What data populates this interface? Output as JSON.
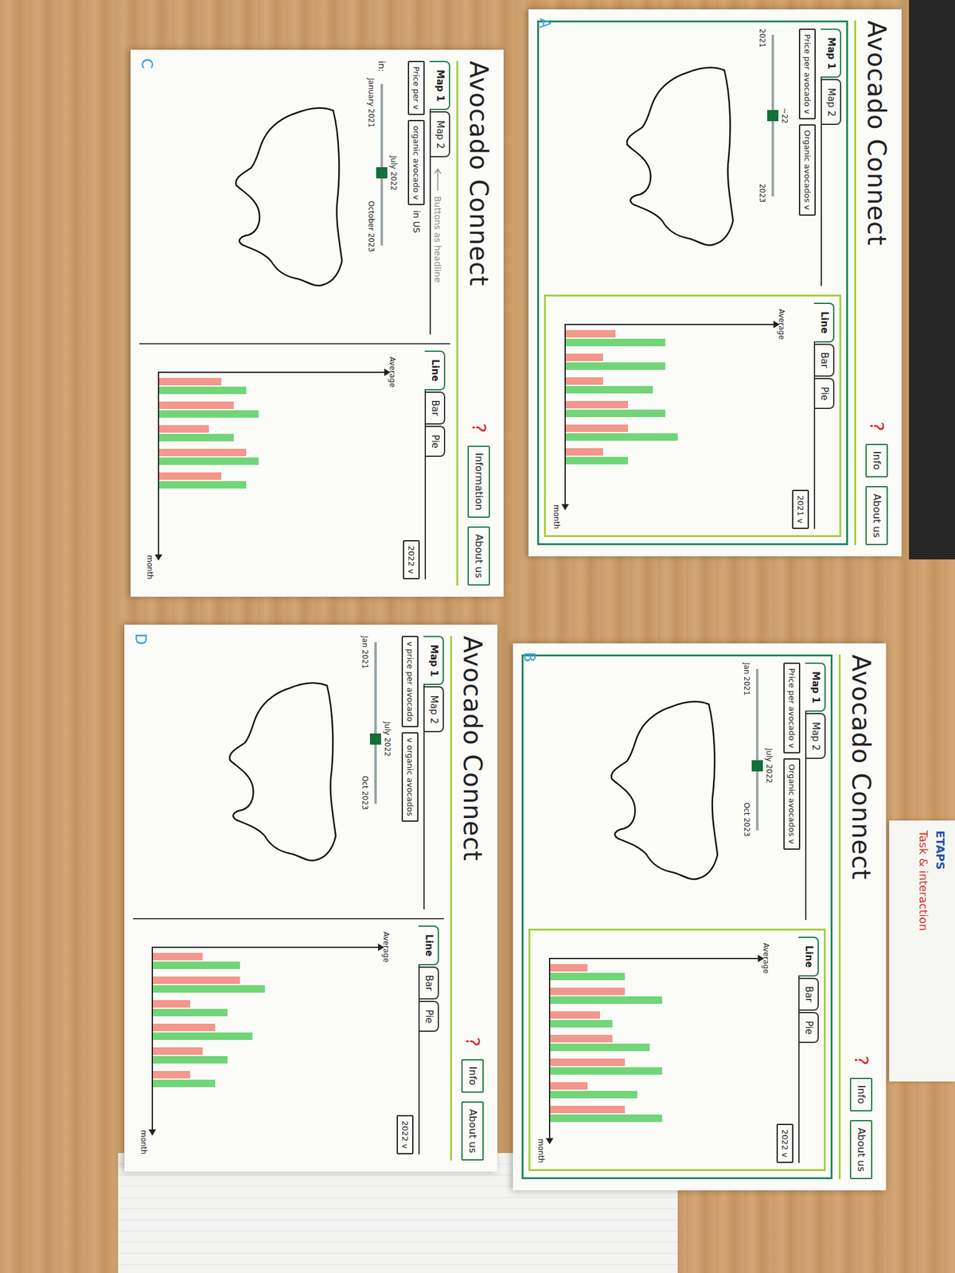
{
  "sheets": [
    {
      "label": "A",
      "kind": "framed",
      "title": "Avocado Connect",
      "help": "?",
      "buttons": [
        "Info",
        "About us"
      ],
      "map_tabs": [
        {
          "label": "Map 1",
          "selected": true
        },
        {
          "label": "Map 2",
          "selected": false
        }
      ],
      "filters": [
        "Price per avocado v",
        "Organic avocados v"
      ],
      "slider": {
        "start": "2021",
        "current": "~22",
        "end": "2023",
        "level": 0.5
      },
      "chart_tabs": [
        {
          "label": "Line",
          "selected": true
        },
        {
          "label": "Bar",
          "selected": false
        },
        {
          "label": "Pie",
          "selected": false
        }
      ],
      "year": "2021 v",
      "y_label": "Average",
      "x_label": "month",
      "series": [
        {
          "color": "#f2857a",
          "values": [
            4,
            3,
            3,
            5,
            5,
            3
          ]
        },
        {
          "color": "#58cf62",
          "values": [
            8,
            8,
            7,
            8,
            9,
            5
          ]
        }
      ]
    },
    {
      "label": "B",
      "kind": "framed",
      "title": "Avocado Connect",
      "help": "?",
      "buttons": [
        "Info",
        "About us"
      ],
      "map_tabs": [
        {
          "label": "Map 1",
          "selected": true
        },
        {
          "label": "Map 2",
          "selected": false
        }
      ],
      "filters": [
        "Price per avocado v",
        "Organic avocados v"
      ],
      "slider": {
        "start": "Jan 2021",
        "current": "July 2022",
        "end": "Oct 2023",
        "level": 0.6
      },
      "chart_tabs": [
        {
          "label": "Line",
          "selected": true
        },
        {
          "label": "Bar",
          "selected": false
        },
        {
          "label": "Pie",
          "selected": false
        }
      ],
      "year": "2022 v",
      "y_label": "Average",
      "x_label": "month",
      "series": [
        {
          "color": "#f2857a",
          "values": [
            3,
            6,
            4,
            5,
            6,
            3,
            6
          ]
        },
        {
          "color": "#58cf62",
          "values": [
            6,
            9,
            5,
            8,
            9,
            7,
            9
          ]
        }
      ]
    },
    {
      "label": "C",
      "kind": "open",
      "title": "Avocado Connect",
      "help": "?",
      "buttons": [
        "Information",
        "About us"
      ],
      "map_tabs": [
        {
          "label": "Map 1",
          "selected": true
        },
        {
          "label": "Map 2",
          "selected": false
        }
      ],
      "note": "Buttons as headline",
      "filters": [
        "Price per v",
        "organic avocado v"
      ],
      "filter_suffix": "in US",
      "slider_prefix": "in:",
      "slider": {
        "start": "January 2021",
        "current": "July 2022",
        "end": "October 2023",
        "level": 0.55
      },
      "chart_tabs": [
        {
          "label": "Line",
          "selected": true
        },
        {
          "label": "Bar",
          "selected": false
        },
        {
          "label": "Pie",
          "selected": false
        }
      ],
      "year": "2022 v",
      "y_label": "Average",
      "x_label": "month",
      "series": [
        {
          "color": "#f2857a",
          "values": [
            5,
            6,
            4,
            7,
            5
          ]
        },
        {
          "color": "#58cf62",
          "values": [
            7,
            8,
            6,
            8,
            7
          ]
        }
      ]
    },
    {
      "label": "D",
      "kind": "open",
      "title": "Avocado Connect",
      "help": "?",
      "buttons": [
        "Info",
        "About us"
      ],
      "map_tabs": [
        {
          "label": "Map 1",
          "selected": true
        },
        {
          "label": "Map 2",
          "selected": false
        }
      ],
      "filters": [
        "v price per avocado",
        "v organic avocados"
      ],
      "slider": {
        "start": "Jan 2021",
        "current": "July 2022",
        "end": "Oct 2023",
        "level": 0.6
      },
      "chart_tabs": [
        {
          "label": "Line",
          "selected": true
        },
        {
          "label": "Bar",
          "selected": false
        },
        {
          "label": "Pie",
          "selected": false
        }
      ],
      "year": "2022 v",
      "y_label": "Average",
      "x_label": "month",
      "series": [
        {
          "color": "#f2857a",
          "values": [
            4,
            7,
            3,
            5,
            4,
            3
          ]
        },
        {
          "color": "#58cf62",
          "values": [
            7,
            9,
            6,
            8,
            6,
            5
          ]
        }
      ]
    }
  ],
  "sticky_note": {
    "lines": [
      "ETAPS",
      "Task & interaction"
    ]
  }
}
